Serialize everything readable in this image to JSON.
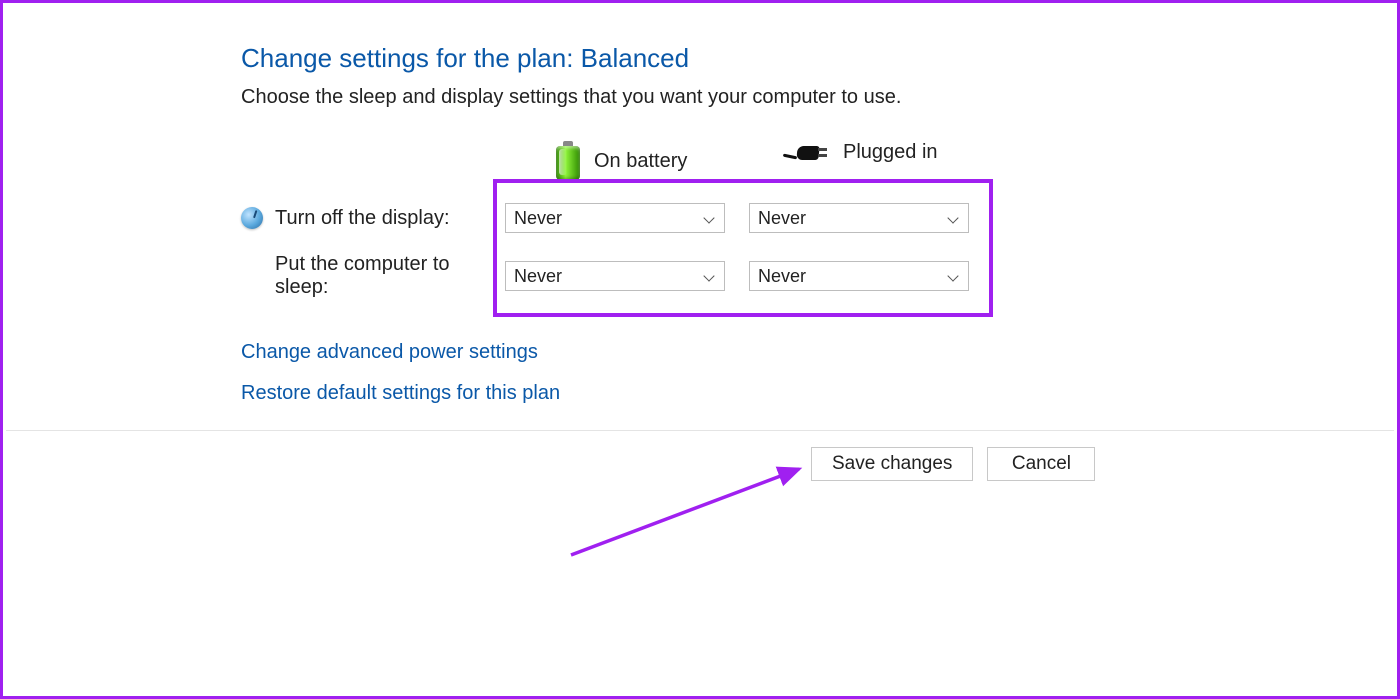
{
  "title": "Change settings for the plan: Balanced",
  "subtitle": "Choose the sleep and display settings that you want your computer to use.",
  "columns": {
    "battery": "On battery",
    "plugged": "Plugged in"
  },
  "rows": {
    "display": {
      "label": "Turn off the display:",
      "battery": "Never",
      "plugged": "Never"
    },
    "sleep": {
      "label": "Put the computer to sleep:",
      "battery": "Never",
      "plugged": "Never"
    }
  },
  "links": {
    "advanced": "Change advanced power settings",
    "restore": "Restore default settings for this plan"
  },
  "buttons": {
    "save": "Save changes",
    "cancel": "Cancel"
  },
  "highlight_color": "#a020f0"
}
